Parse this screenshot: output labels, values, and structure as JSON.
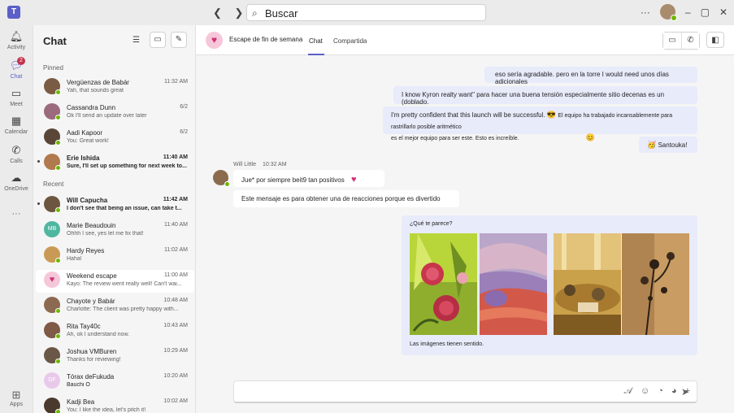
{
  "titlebar": {
    "back_icon": "chevron-left",
    "forward_icon": "chevron-right",
    "search_placeholder": "Buscar",
    "more_label": "···",
    "window_controls": [
      "–",
      "▢",
      "✕"
    ]
  },
  "rail": {
    "items": [
      {
        "label": "Activity",
        "icon": "bell"
      },
      {
        "label": "Chat",
        "icon": "chat",
        "badge": "2"
      },
      {
        "label": "Meet",
        "icon": "video"
      },
      {
        "label": "Calendar",
        "icon": "calendar"
      },
      {
        "label": "Calls",
        "icon": "phone"
      },
      {
        "label": "OneDrive",
        "icon": "cloud"
      }
    ],
    "more_label": "···",
    "apps_label": "Apps"
  },
  "chatlist": {
    "title": "Chat",
    "pinned_label": "Pinned",
    "recent_label": "Recent",
    "pinned": [
      {
        "name": "Vergüenzas de Babár",
        "preview": "Yah, that sounds great",
        "time": "11:32 AM",
        "avatar_color": "#7a5b44"
      },
      {
        "name": "Cassandra Dunn",
        "preview": "Ok I'll send an update over later",
        "time": "6/2",
        "avatar_color": "#9c6a7d"
      },
      {
        "name": "Aadi Kapoor",
        "preview": "You: Great work!",
        "time": "6/2",
        "avatar_color": "#5a4636"
      },
      {
        "name": "Erie Ishida",
        "preview": "Sure, I'll set up something for next week to...",
        "time": "11:40 AM",
        "avatar_color": "#b07a4e",
        "unread": true
      }
    ],
    "recent": [
      {
        "name": "Will Capucha",
        "preview": "I don't see that being an issue, can take t...",
        "time": "11:42 AM",
        "avatar_color": "#6d5640",
        "unread": true
      },
      {
        "name": "Marie Beaudouin",
        "preview": "Ohhh I see, yes let me fix that!",
        "time": "11:40 AM",
        "avatar_color": "#4fb6a0",
        "initials": "MB"
      },
      {
        "name": "Hardy Reyes",
        "preview": "Haha!",
        "time": "11:02 AM",
        "avatar_color": "#c99a56"
      },
      {
        "name": "Weekend escape",
        "preview": "Kayo: The review went really well! Can't wai...",
        "time": "11:00 AM",
        "avatar_color": "#f6c7d9",
        "selected": true
      },
      {
        "name": "Chayote y Babár",
        "preview": "Charlotte: The client was pretty happy with...",
        "time": "10:48 AM",
        "avatar_color": "#8c6a52"
      },
      {
        "name": "Rita Tay40c",
        "preview": "Ah, ok I understand now.",
        "time": "10:43 AM",
        "avatar_color": "#7e5a47"
      },
      {
        "name": "Joshua VMBuren",
        "preview": "Thanks for reviewing!",
        "time": "10:29 AM",
        "avatar_color": "#6b5747"
      },
      {
        "name": "Tórax deFukuda",
        "name2": "Bauchi O",
        "time": "10:20 AM",
        "avatar_color": "#e9c9ea",
        "initials": "DF"
      },
      {
        "name": "Kadji Bea",
        "preview": "You: I like the idea, let's pitch it!",
        "time": "10:02 AM",
        "avatar_color": "#4a3a2d"
      }
    ]
  },
  "conversation": {
    "group_name": "Escape de fin de semana",
    "tabs": [
      "Chat",
      "Compartida"
    ],
    "messages_out": [
      "eso sería agradable. pero en la torre I would need unos días adicionales",
      "I know Kyron realty want\" para hacer una buena tensión especialmente sitio decenas es un (doblado.",
      "I'm pretty confident that this launch will be successful.",
      "El equipo ha trabajado incansablemente para rastrillarlo posible aritmético",
      "es el mejor equipo para ser este. Esto es increíble.",
      "Santouka!"
    ],
    "sender": "Will Little",
    "sender_time": "10:32 AM",
    "messages_in": [
      "Jue* por siempre beit9 tan positivos",
      "Este mensaje es para obtener una de reacciones porque es divertido"
    ],
    "photo_question": "¿Qué te parece?",
    "photo_caption": "Las imágenes tienen sentido.",
    "composer_placeholder": ""
  },
  "colors": {
    "accent": "#5b5fc7",
    "bubble_self": "#e8ebfa",
    "presence": "#6bb700",
    "heart": "#d03277"
  }
}
